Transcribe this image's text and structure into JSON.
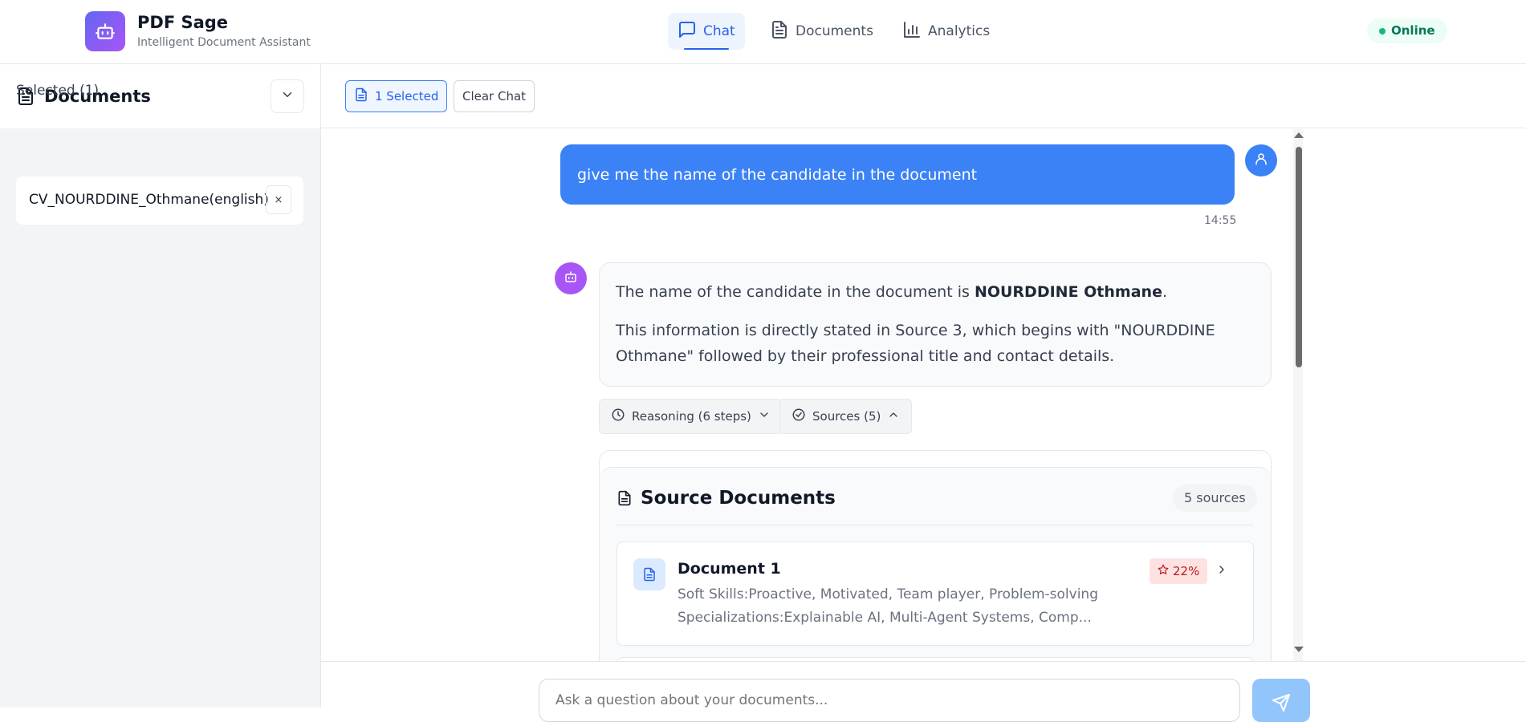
{
  "app": {
    "title": "PDF Sage",
    "subtitle": "Intelligent Document Assistant",
    "status": "Online"
  },
  "nav": [
    {
      "label": "Chat",
      "icon": "chat-icon",
      "active": true
    },
    {
      "label": "Documents",
      "icon": "document-icon",
      "active": false
    },
    {
      "label": "Analytics",
      "icon": "bar-chart-icon",
      "active": false
    }
  ],
  "sidebar": {
    "title": "Documents",
    "selected_label": "Selected (1)",
    "selected_docs": [
      {
        "name": "CV_NOURDDINE_Othmane(english)",
        "remove": "×"
      }
    ]
  },
  "toolbar": {
    "selected_button": "1 Selected",
    "clear_button": "Clear Chat"
  },
  "messages": {
    "user": {
      "text": "give me the name of the candidate in the document",
      "time": "14:55"
    },
    "assistant": {
      "line1_prefix": "The name of the candidate in the document is ",
      "line1_bold": "NOURDDINE Othmane",
      "line1_suffix": ".",
      "line2": "This information is directly stated in Source 3, which begins with \"NOURDDINE Othmane\" followed by their professional title and contact details.",
      "reasoning_label": "Reasoning (6 steps)",
      "sources_label": "Sources (5)"
    }
  },
  "sources": {
    "title": "Source Documents",
    "count": "5 sources",
    "items": [
      {
        "name": "Document 1",
        "snippet": "Soft Skills:Proactive, Motivated, Team player, Problem-solving Specializations:Explainable AI, Multi-Agent Systems, Comp...",
        "score": "22%"
      }
    ]
  },
  "composer": {
    "placeholder": "Ask a question about your documents..."
  },
  "colors": {
    "accent": "#3b82f6",
    "bot": "#a855f7",
    "online": "#10b981"
  }
}
